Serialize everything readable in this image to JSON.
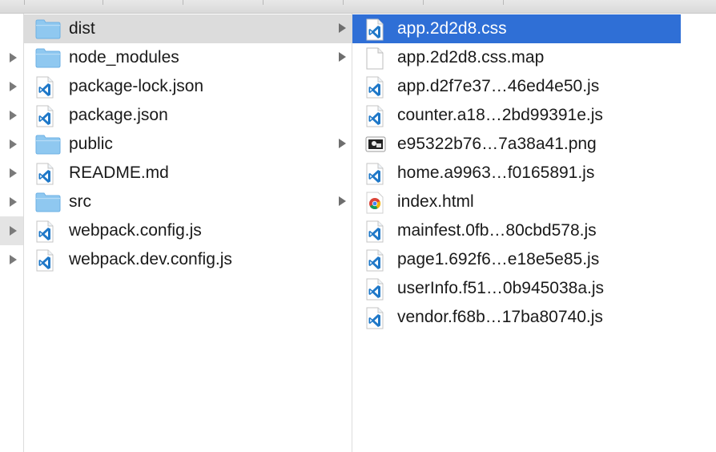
{
  "columns": {
    "parent": {
      "items": [
        {
          "label": "dist",
          "kind": "folder",
          "expandable": true,
          "selected": "gray"
        },
        {
          "label": "node_modules",
          "kind": "folder",
          "expandable": true
        },
        {
          "label": "package-lock.json",
          "kind": "vscode-file",
          "expandable": false
        },
        {
          "label": "package.json",
          "kind": "vscode-file",
          "expandable": false
        },
        {
          "label": "public",
          "kind": "folder",
          "expandable": true
        },
        {
          "label": "README.md",
          "kind": "vscode-file",
          "expandable": false
        },
        {
          "label": "src",
          "kind": "folder",
          "expandable": true
        },
        {
          "label": "webpack.config.js",
          "kind": "vscode-file",
          "expandable": false
        },
        {
          "label": "webpack.dev.config.js",
          "kind": "vscode-file",
          "expandable": false
        }
      ]
    },
    "dist": {
      "items": [
        {
          "label": "app.2d2d8.css",
          "kind": "vscode-file",
          "selected": "blue"
        },
        {
          "label": "app.2d2d8.css.map",
          "kind": "blank-file"
        },
        {
          "label": "app.d2f7e37…46ed4e50.js",
          "kind": "vscode-file"
        },
        {
          "label": "counter.a18…2bd99391e.js",
          "kind": "vscode-file"
        },
        {
          "label": "e95322b76…7a38a41.png",
          "kind": "image-file"
        },
        {
          "label": "home.a9963…f0165891.js",
          "kind": "vscode-file"
        },
        {
          "label": "index.html",
          "kind": "chrome-file"
        },
        {
          "label": "mainfest.0fb…80cbd578.js",
          "kind": "vscode-file"
        },
        {
          "label": "page1.692f6…e18e5e85.js",
          "kind": "vscode-file"
        },
        {
          "label": "userInfo.f51…0b945038a.js",
          "kind": "vscode-file"
        },
        {
          "label": "vendor.f68b…17ba80740.js",
          "kind": "vscode-file"
        }
      ]
    }
  },
  "left_gutter": {
    "arrows": [
      false,
      true,
      true,
      true,
      true,
      true,
      true,
      true,
      true
    ],
    "highlighted_row": 7
  },
  "colors": {
    "selection_blue": "#2f6fd6",
    "selection_gray": "#dcdcdc",
    "folder_blue": "#8fc8f0",
    "vscode_blue": "#1f78c8"
  }
}
